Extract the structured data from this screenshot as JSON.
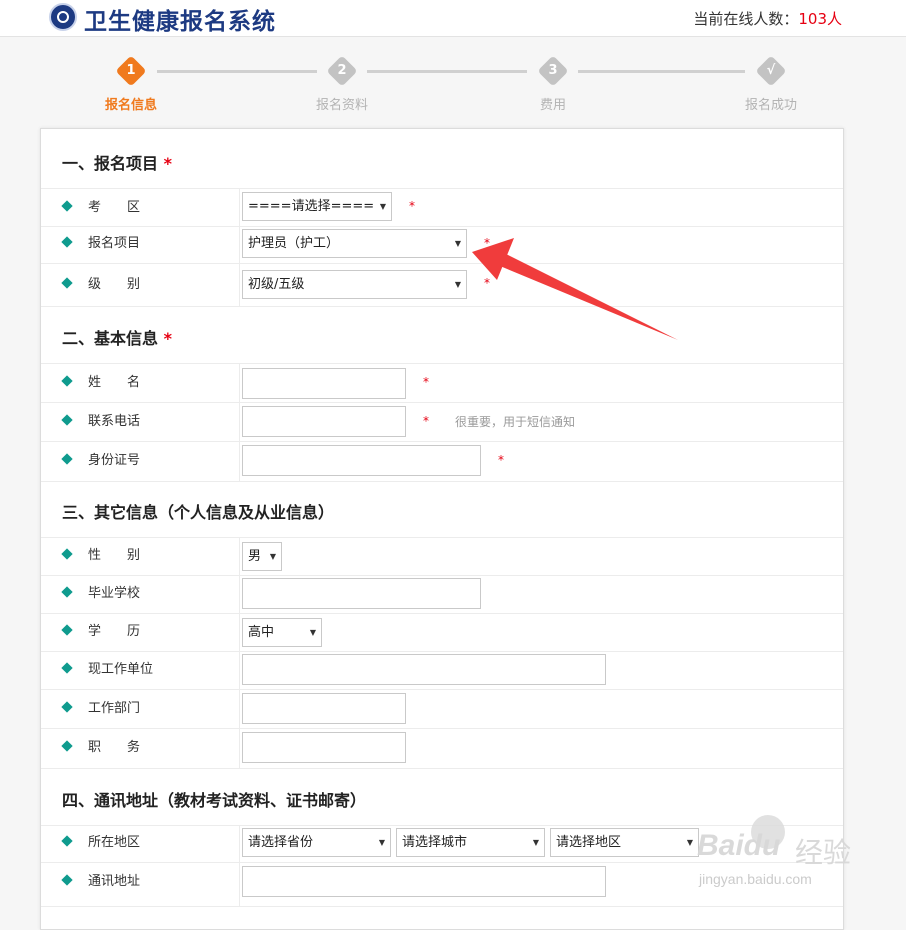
{
  "header": {
    "title": "卫生健康报名系统",
    "online_label": "当前在线人数：",
    "online_count": "103人"
  },
  "steps": [
    {
      "num": "1",
      "label": "报名信息"
    },
    {
      "num": "2",
      "label": "报名资料"
    },
    {
      "num": "3",
      "label": "费用"
    },
    {
      "num": "√",
      "label": "报名成功"
    }
  ],
  "sections": {
    "s1": "一、报名项目",
    "s2": "二、基本信息",
    "s3": "三、其它信息（个人信息及从业信息）",
    "s4": "四、通讯地址（教材考试资料、证书邮寄）",
    "required_mark": "*"
  },
  "labels": {
    "exam_area": "考　　区",
    "project": "报名项目",
    "level": "级　　别",
    "name": "姓　　名",
    "phone": "联系电话",
    "id_number": "身份证号",
    "gender": "性　　别",
    "school": "毕业学校",
    "education": "学　　历",
    "work_unit": "现工作单位",
    "department": "工作部门",
    "position": "职　　务",
    "region": "所在地区",
    "address": "通讯地址"
  },
  "fields": {
    "exam_area_value": "====请选择====",
    "project_value": "护理员（护工）",
    "level_value": "初级/五级",
    "name_value": "",
    "phone_value": "",
    "phone_hint": "很重要，用于短信通知",
    "id_value": "",
    "gender_value": "男",
    "school_value": "",
    "education_value": "高中",
    "work_unit_value": "",
    "department_value": "",
    "position_value": "",
    "province_value": "请选择省份",
    "city_value": "请选择城市",
    "district_value": "请选择地区",
    "address_value": ""
  },
  "watermark": {
    "brand": "Baidu",
    "cn": "经验",
    "url": "jingyan.baidu.com"
  },
  "colors": {
    "accent": "#f07a1e",
    "brand": "#1d3a82",
    "bullet": "#0f9b8e",
    "required": "#e60012",
    "arrow": "#f03c3c"
  }
}
